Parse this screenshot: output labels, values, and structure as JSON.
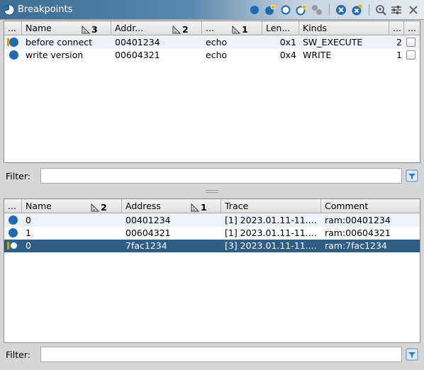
{
  "window": {
    "title": "Breakpoints",
    "toolbar_icons": [
      "enable-breakpoint-icon",
      "enable-all-icon",
      "disable-breakpoint-icon",
      "disable-all-icon",
      "make-selected-icon",
      "clear-breakpoint-icon",
      "clear-all-icon",
      "filter-icon",
      "configure-icon",
      "close-icon"
    ]
  },
  "breakpoints_table": {
    "columns": [
      {
        "label": "..."
      },
      {
        "label": "Name",
        "sort_rank": "3"
      },
      {
        "label": "Addr...",
        "sort_rank": "2"
      },
      {
        "label": "...",
        "sort_rank": "1"
      },
      {
        "label": "Len..."
      },
      {
        "label": "Kinds"
      },
      {
        "label": "..."
      },
      {
        "label": "..."
      }
    ],
    "rows": [
      {
        "name": "before connect",
        "address": "00401234",
        "target": "echo",
        "length": "0x1",
        "kinds": "SW_EXECUTE",
        "locations": "2",
        "enabled_state": "enabled-warning"
      },
      {
        "name": "write version",
        "address": "00604321",
        "target": "echo",
        "length": "0x4",
        "kinds": "WRITE",
        "locations": "1",
        "enabled_state": "enabled"
      }
    ]
  },
  "locations_table": {
    "columns": [
      {
        "label": "..."
      },
      {
        "label": "Name",
        "sort_rank": "2"
      },
      {
        "label": "Address",
        "sort_rank": "1"
      },
      {
        "label": "Trace"
      },
      {
        "label": "Comment"
      }
    ],
    "rows": [
      {
        "name": "0",
        "address": "00401234",
        "trace": "[1] 2023.01.11-11....",
        "comment": "ram:00401234",
        "state": "enabled"
      },
      {
        "name": "1",
        "address": "00604321",
        "trace": "[1] 2023.01.11-11....",
        "comment": "ram:00604321",
        "state": "enabled"
      },
      {
        "name": "0",
        "address": "7fac1234",
        "trace": "[3] 2023.01.11-11....",
        "comment": "ram:7fac1234",
        "state": "disabled-warning",
        "selected": true
      }
    ]
  },
  "filters": {
    "top_label": "Filter:",
    "top_value": "",
    "bottom_label": "Filter:",
    "bottom_value": ""
  },
  "colors": {
    "title_bar": "#3d6d95",
    "selection": "#2e5d86",
    "breakpoint_blue": "#1f6ab5",
    "warning": "#d6a000"
  }
}
